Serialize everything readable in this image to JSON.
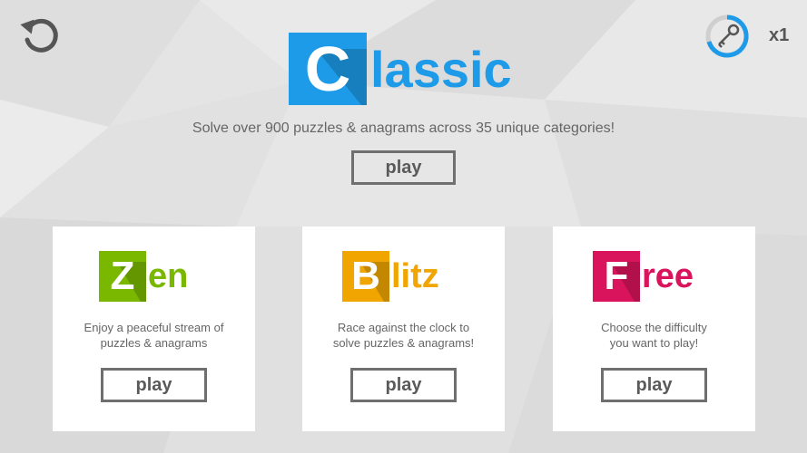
{
  "header": {
    "key_count": "x1"
  },
  "colors": {
    "classic": "#1e9be8",
    "zen": "#7ab800",
    "blitz": "#f0a500",
    "free": "#d9145c"
  },
  "classic": {
    "logo_letter": "C",
    "logo_rest": "lassic",
    "description": "Solve over 900 puzzles & anagrams across 35 unique categories!",
    "play_label": "play"
  },
  "modes": [
    {
      "logo_letter": "Z",
      "logo_rest": "en",
      "desc_line1": "Enjoy a peaceful stream of",
      "desc_line2": "puzzles & anagrams",
      "play_label": "play"
    },
    {
      "logo_letter": "B",
      "logo_rest": "litz",
      "desc_line1": "Race against the clock to",
      "desc_line2": "solve puzzles & anagrams!",
      "play_label": "play"
    },
    {
      "logo_letter": "F",
      "logo_rest": "ree",
      "desc_line1": "Choose the difficulty",
      "desc_line2": "you want to play!",
      "play_label": "play"
    }
  ]
}
